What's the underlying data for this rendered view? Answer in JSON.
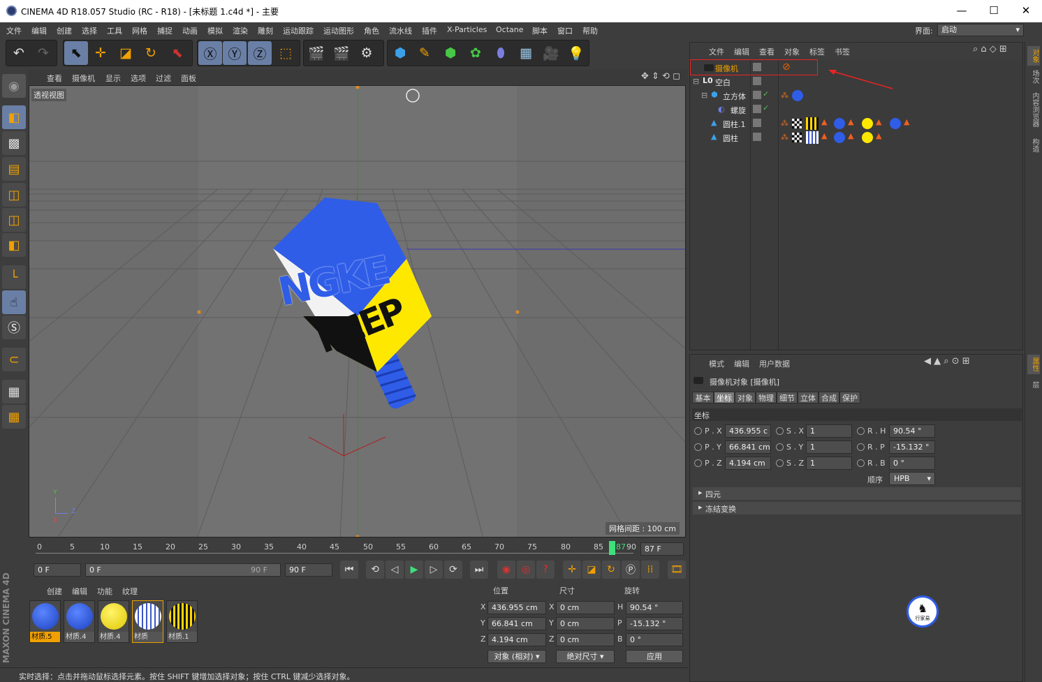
{
  "window": {
    "title": "CINEMA 4D R18.057 Studio (RC - R18) - [未标题 1.c4d *] - 主要",
    "minimize": "—",
    "maximize": "☐",
    "close": "✕"
  },
  "menu": [
    "文件",
    "编辑",
    "创建",
    "选择",
    "工具",
    "网格",
    "捕捉",
    "动画",
    "模拟",
    "渲染",
    "雕刻",
    "运动跟踪",
    "运动图形",
    "角色",
    "流水线",
    "插件",
    "X-Particles",
    "Octane",
    "脚本",
    "窗口",
    "帮助"
  ],
  "layout": {
    "label": "界面:",
    "value": "启动"
  },
  "viewport": {
    "menu": [
      "查看",
      "摄像机",
      "显示",
      "选项",
      "过滤",
      "面板"
    ],
    "label": "透视视图",
    "grid_spacing": "网格间距 : 100 cm",
    "cube_text_top": "NGKE",
    "cube_text_side": "KEEP",
    "axis": {
      "y": "Y",
      "z": "Z",
      "x": "X"
    }
  },
  "timeline": {
    "ticks": [
      "0",
      "5",
      "10",
      "15",
      "20",
      "25",
      "30",
      "35",
      "40",
      "45",
      "50",
      "55",
      "60",
      "65",
      "70",
      "75",
      "80",
      "85",
      "90"
    ],
    "current": "87",
    "current_field": "87 F"
  },
  "playback": {
    "start": "0 F",
    "range_start": "0 F",
    "range_end": "90 F",
    "end": "90 F"
  },
  "materials": {
    "menu": [
      "创建",
      "编辑",
      "功能",
      "纹理"
    ],
    "items": [
      {
        "name": "材质.5",
        "color": "#2a5de0",
        "selected": true
      },
      {
        "name": "材质.4",
        "color": "#2f5de8",
        "selected": false
      },
      {
        "name": "材质.4",
        "color": "#ffe800",
        "selected": false
      },
      {
        "name": "材质",
        "color": "#e8eef8",
        "selected": false
      },
      {
        "name": "材质.1",
        "color": "#d9b400",
        "selected": false
      }
    ]
  },
  "coords": {
    "headers": [
      "位置",
      "尺寸",
      "旋转"
    ],
    "rows": [
      {
        "axis": "X",
        "pos": "436.955 cm",
        "size_axis": "X",
        "size": "0 cm",
        "rot_axis": "H",
        "rot": "90.54 °"
      },
      {
        "axis": "Y",
        "pos": "66.841 cm",
        "size_axis": "Y",
        "size": "0 cm",
        "rot_axis": "P",
        "rot": "-15.132 °"
      },
      {
        "axis": "Z",
        "pos": "4.194 cm",
        "size_axis": "Z",
        "size": "0 cm",
        "rot_axis": "B",
        "rot": "0 °"
      }
    ],
    "mode": "对象 (相对)",
    "size_mode": "绝对尺寸",
    "apply": "应用"
  },
  "status": "实时选择：点击并拖动鼠标选择元素。按住 SHIFT 键增加选择对象；按住 CTRL 键减少选择对象。",
  "maxon": "MAXON CINEMA 4D",
  "objects": {
    "menu": [
      "文件",
      "编辑",
      "查看",
      "对象",
      "标签",
      "书签"
    ],
    "items": [
      {
        "name": "摄像机",
        "indent": 0,
        "highlight": true
      },
      {
        "name": "空白",
        "indent": 0,
        "highlight": false
      },
      {
        "name": "立方体",
        "indent": 1,
        "highlight": false
      },
      {
        "name": "螺旋",
        "indent": 2,
        "highlight": false
      },
      {
        "name": "圆柱.1",
        "indent": 1,
        "highlight": false
      },
      {
        "name": "圆柱",
        "indent": 1,
        "highlight": false
      }
    ]
  },
  "attributes": {
    "menu": [
      "模式",
      "编辑",
      "用户数据"
    ],
    "title": "摄像机对象 [摄像机]",
    "tabs": [
      "基本",
      "坐标",
      "对象",
      "物理",
      "细节",
      "立体",
      "合成",
      "保护"
    ],
    "active_tab": "坐标",
    "section": "坐标",
    "fields": [
      {
        "p_label": "P . X",
        "p": "436.955 c",
        "s_label": "S . X",
        "s": "1",
        "r_label": "R . H",
        "r": "90.54 °"
      },
      {
        "p_label": "P . Y",
        "p": "66.841 cm",
        "s_label": "S . Y",
        "s": "1",
        "r_label": "R . P",
        "r": "-15.132 °"
      },
      {
        "p_label": "P . Z",
        "p": "4.194 cm",
        "s_label": "S . Z",
        "s": "1",
        "r_label": "R . B",
        "r": "0 °"
      }
    ],
    "order_label": "顺序",
    "order": "HPB",
    "quaternion": "四元",
    "freeze": "冻结变换"
  },
  "sidetabs": [
    "对象",
    "场次",
    "内容浏览器",
    "构造",
    "属性",
    "层"
  ],
  "watermark": "行家易"
}
